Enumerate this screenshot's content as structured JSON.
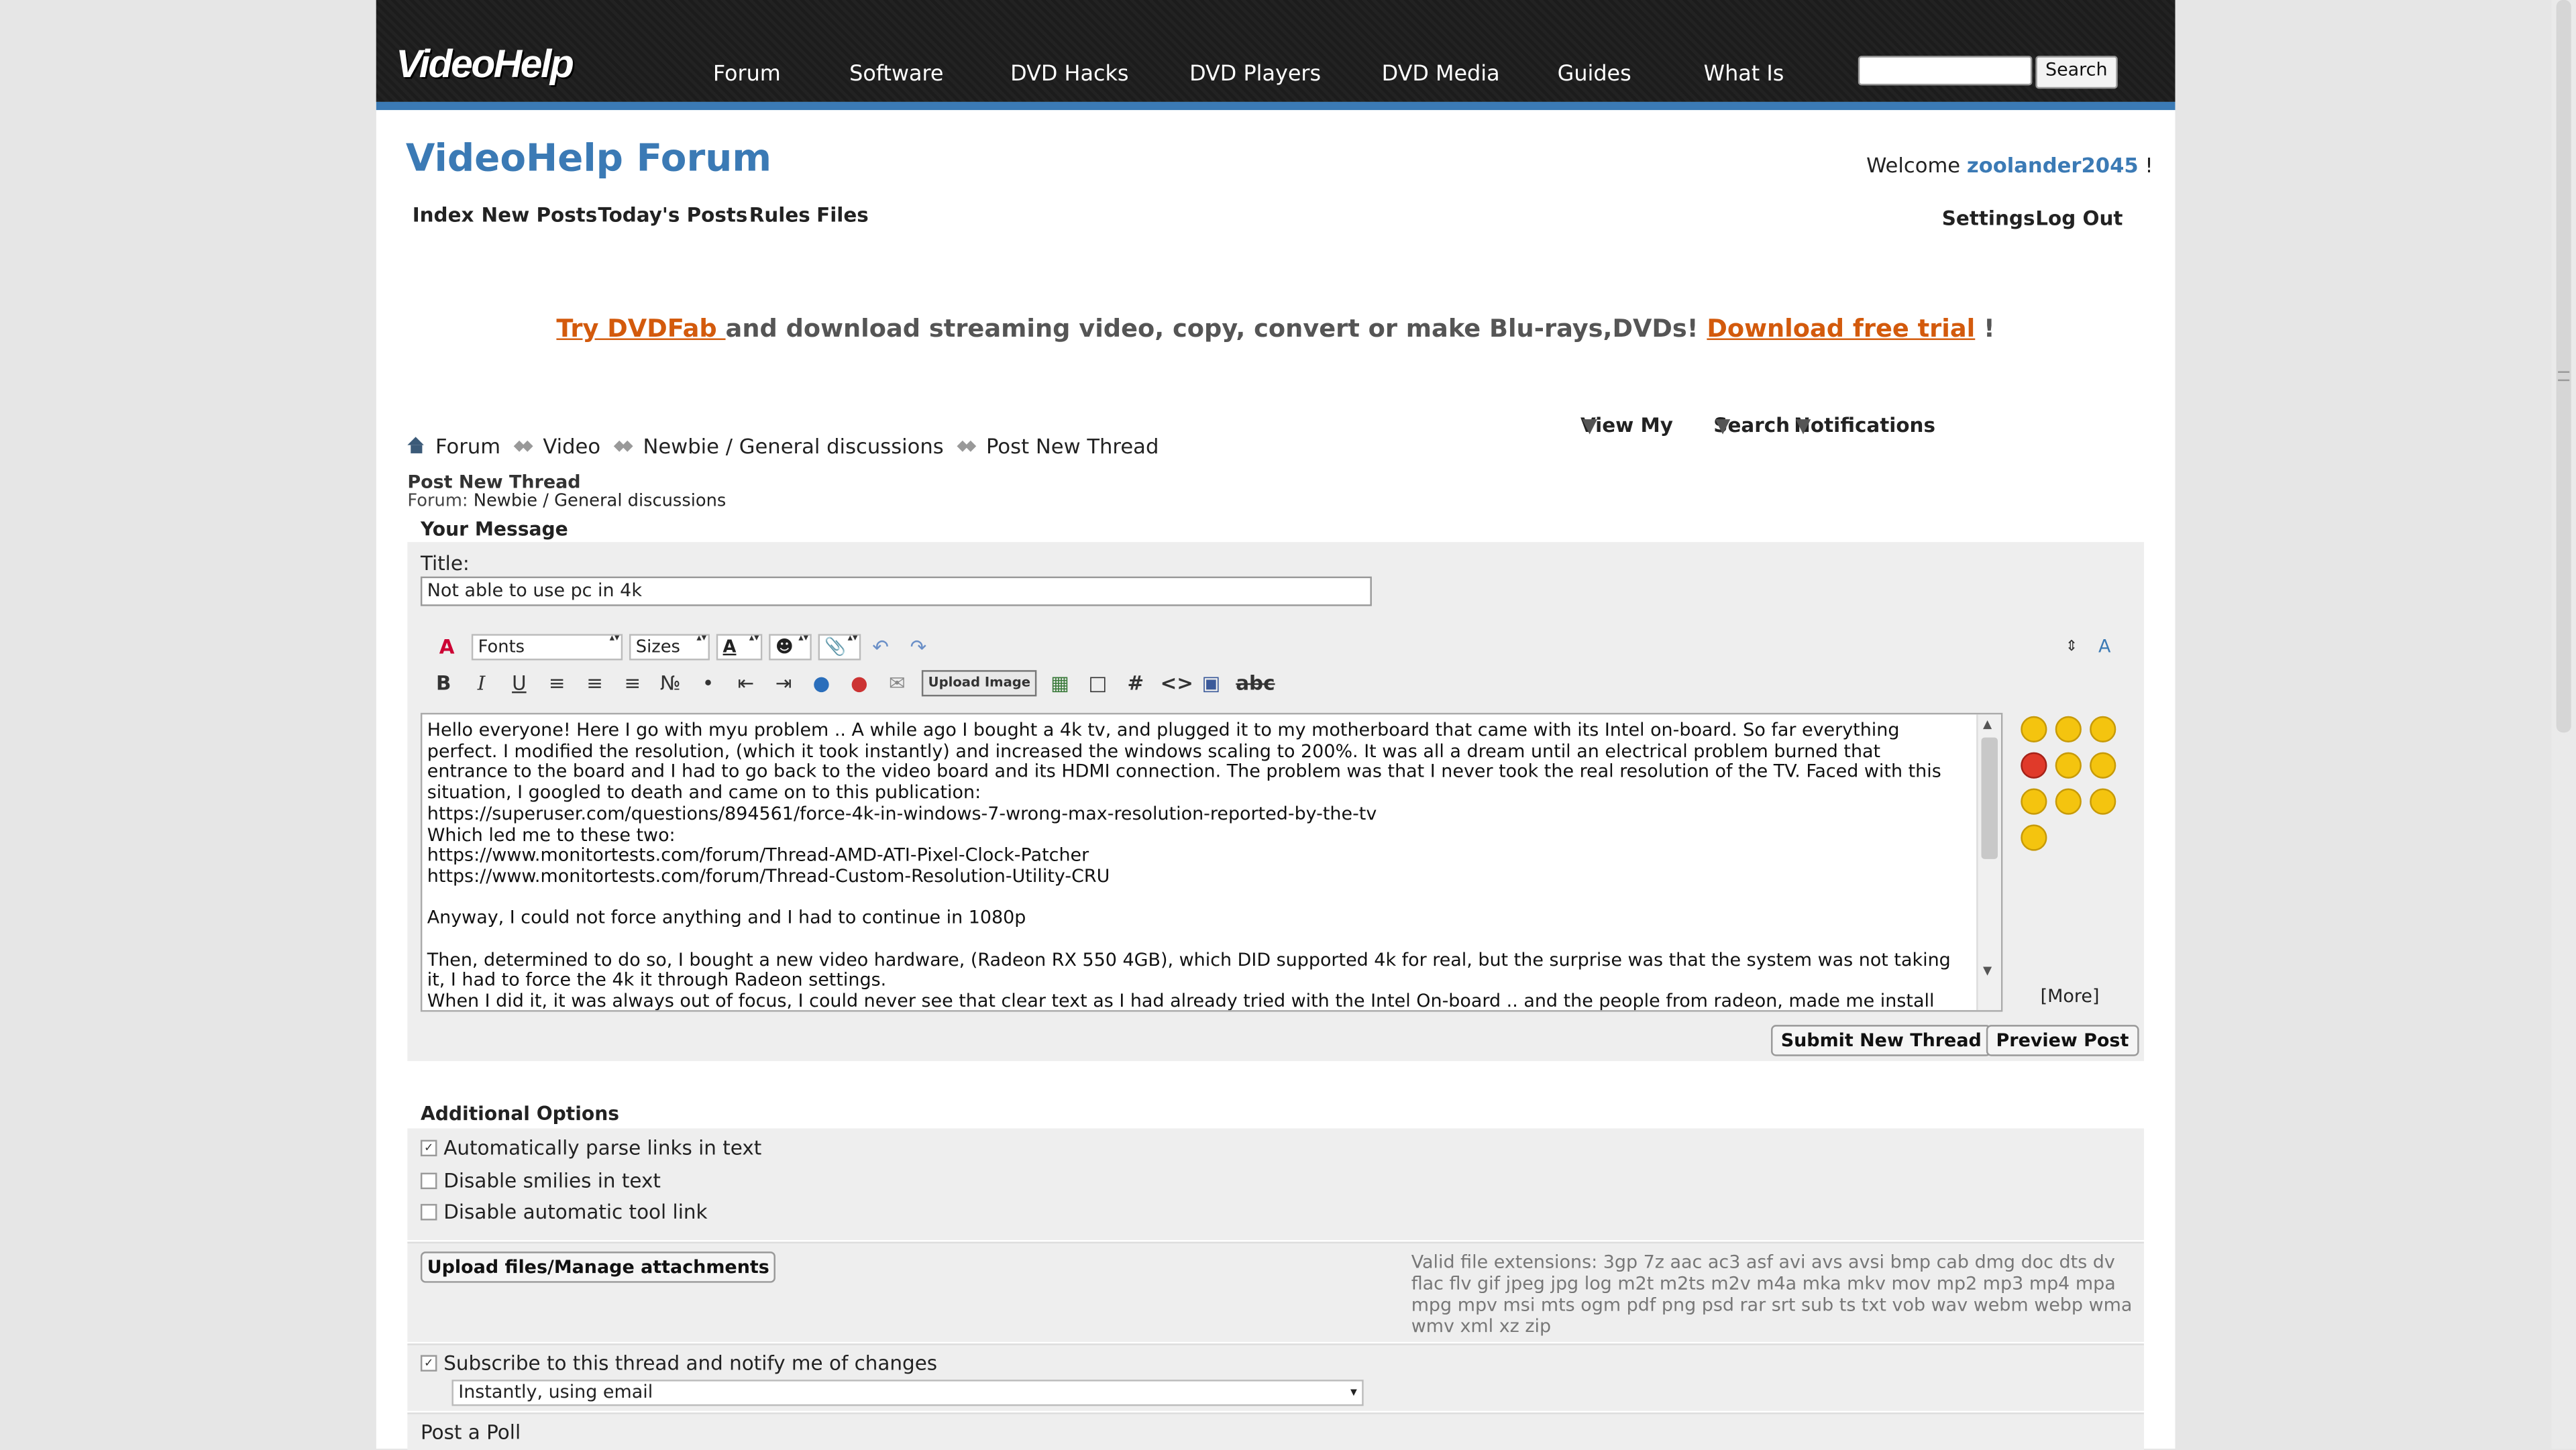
{
  "header": {
    "logo": "VideoHelp",
    "nav": [
      "Forum",
      "Software",
      "DVD Hacks",
      "DVD Players",
      "DVD Media",
      "Guides",
      "What Is"
    ],
    "search_button": "Search"
  },
  "forum": {
    "title": "VideoHelp Forum",
    "welcome_prefix": "Welcome",
    "username": "zoolander2045",
    "welcome_suffix": "!",
    "left_nav": [
      "Index",
      "New Posts",
      "Today's Posts",
      "Rules",
      "Files"
    ],
    "right_nav": [
      "View My",
      "Search",
      "Notifications",
      "Settings",
      "Log Out"
    ]
  },
  "promo": {
    "link1": "Try DVDFab ",
    "middle": "and download streaming video, copy, convert or make Blu-rays,DVDs! ",
    "link2": "Download free trial",
    "end": " !"
  },
  "breadcrumb": [
    "Forum",
    "Video",
    "Newbie / General discussions",
    "Post New Thread"
  ],
  "page": {
    "heading": "Post New Thread",
    "forum_label": "Forum:",
    "forum_name": "Newbie / General discussions",
    "your_message": "Your Message"
  },
  "form": {
    "title_label": "Title:",
    "title_value": "Not able to use pc in 4k",
    "fonts": "Fonts",
    "sizes": "Sizes",
    "upload_image": "Upload Image",
    "message": "Hello everyone! Here I go with myu problem .. A while ago I bought a 4k tv, and plugged it to my motherboard that came with its Intel on-board. So far everything perfect. I modified the resolution, (which it took instantly) and increased the windows scaling to 200%. It was all a dream until an electrical problem burned that entrance to the board and I had to go back to the video board and its HDMI connection. The problem was that I never took the real resolution of the TV. Faced with this situation, I googled to death and came on to this publication:\nhttps://superuser.com/questions/894561/force-4k-in-windows-7-wrong-max-resolution-reported-by-the-tv\nWhich led me to these two:\nhttps://www.monitortests.com/forum/Thread-AMD-ATI-Pixel-Clock-Patcher\nhttps://www.monitortests.com/forum/Thread-Custom-Resolution-Utility-CRU\n\nAnyway, I could not force anything and I had to continue in 1080p\n\nThen, determined to do so, I bought a new video hardware, (Radeon RX 550 4GB), which DID supported 4k for real, but the surprise was that the system was not taking it, I had to force the 4k it through Radeon settings.\nWhen I did it, it was always out of focus, I could never see that clear text as I had already tried with the Intel On-board .. and the people from radeon, made me install and",
    "more_smilies": "[More]",
    "submit": "Submit New Thread",
    "preview": "Preview Post"
  },
  "additional": {
    "title": "Additional Options",
    "options": [
      {
        "label": "Automatically parse links in text",
        "checked": true
      },
      {
        "label": "Disable smilies in text",
        "checked": false
      },
      {
        "label": "Disable automatic tool link",
        "checked": false
      }
    ],
    "upload_button": "Upload files/Manage attachments",
    "valid_extensions": "Valid file extensions: 3gp 7z aac ac3 asf avi avs avsi bmp cab dmg doc dts dv flac flv gif jpeg jpg log m2t m2ts m2v m4a mka mkv mov mp2 mp3 mp4 mpa mpg mpv msi mts ogm pdf png psd rar srt sub ts txt vob wav webm webp wma wmv xml xz zip",
    "subscribe_label": "Subscribe to this thread and notify me of changes",
    "subscribe_checked": true,
    "notify_mode": "Instantly, using email",
    "poll": "Post a Poll"
  },
  "colors": {
    "brand_blue": "#3b7ab5",
    "promo_orange": "#d35a0c",
    "header_dark": "#1f1f1f"
  }
}
